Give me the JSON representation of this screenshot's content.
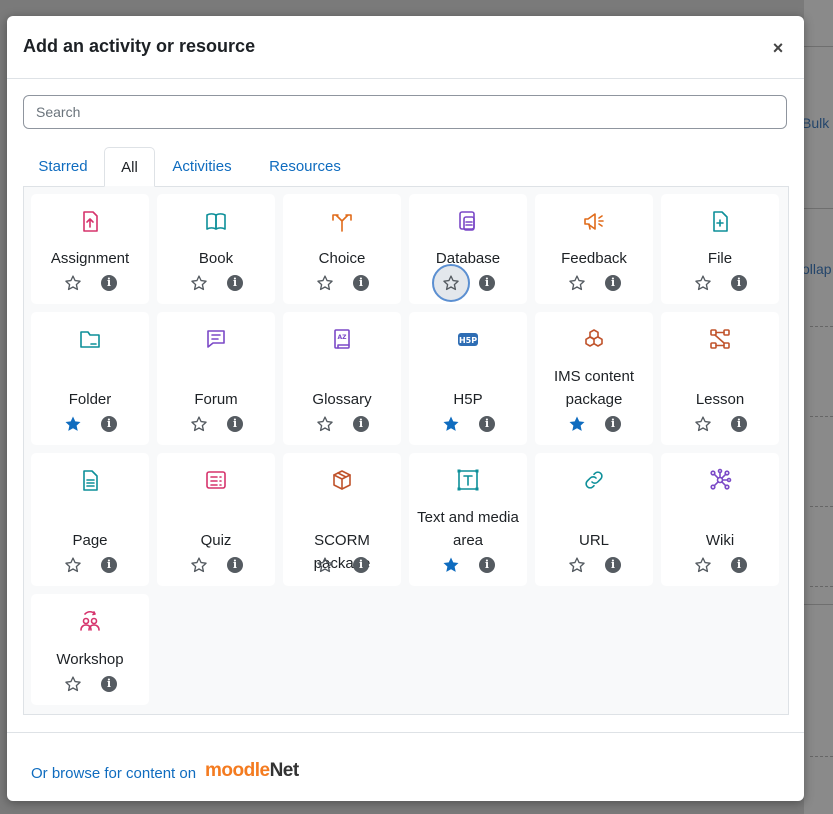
{
  "background": {
    "bulk_text": "Bulk",
    "collapse_text": "ollap"
  },
  "modal": {
    "title": "Add an activity or resource",
    "close_label": "×"
  },
  "search": {
    "placeholder": "Search",
    "value": ""
  },
  "tabs": [
    {
      "label": "Starred",
      "active": false
    },
    {
      "label": "All",
      "active": true
    },
    {
      "label": "Activities",
      "active": false
    },
    {
      "label": "Resources",
      "active": false
    }
  ],
  "items": [
    {
      "name": "Assignment",
      "icon": "assignment-icon",
      "color": "#d6336c",
      "starred": false
    },
    {
      "name": "Book",
      "icon": "book-icon",
      "color": "#0d8f99",
      "starred": false
    },
    {
      "name": "Choice",
      "icon": "choice-icon",
      "color": "#e06b1a",
      "starred": false
    },
    {
      "name": "Database",
      "icon": "database-icon",
      "color": "#7b49c7",
      "starred": false,
      "focused": true
    },
    {
      "name": "Feedback",
      "icon": "feedback-icon",
      "color": "#e06b1a",
      "starred": false
    },
    {
      "name": "File",
      "icon": "file-icon",
      "color": "#0d8f99",
      "starred": false
    },
    {
      "name": "Folder",
      "icon": "folder-icon",
      "color": "#0d8f99",
      "starred": true
    },
    {
      "name": "Forum",
      "icon": "forum-icon",
      "color": "#7b49c7",
      "starred": false
    },
    {
      "name": "Glossary",
      "icon": "glossary-icon",
      "color": "#7b49c7",
      "starred": false
    },
    {
      "name": "H5P",
      "icon": "h5p-icon",
      "color": "#2e6db4",
      "starred": true
    },
    {
      "name": "IMS content package",
      "icon": "ims-package-icon",
      "color": "#c0532b",
      "starred": true
    },
    {
      "name": "Lesson",
      "icon": "lesson-icon",
      "color": "#c0532b",
      "starred": false
    },
    {
      "name": "Page",
      "icon": "page-icon",
      "color": "#0d8f99",
      "starred": false
    },
    {
      "name": "Quiz",
      "icon": "quiz-icon",
      "color": "#d6336c",
      "starred": false
    },
    {
      "name": "SCORM package",
      "icon": "scorm-icon",
      "color": "#c0532b",
      "starred": false
    },
    {
      "name": "Text and media area",
      "icon": "text-media-icon",
      "color": "#0d8f99",
      "starred": true
    },
    {
      "name": "URL",
      "icon": "url-icon",
      "color": "#0d8f99",
      "starred": false
    },
    {
      "name": "Wiki",
      "icon": "wiki-icon",
      "color": "#7b49c7",
      "starred": false
    },
    {
      "name": "Workshop",
      "icon": "workshop-icon",
      "color": "#d6336c",
      "starred": false
    }
  ],
  "info_glyph": "i",
  "footer": {
    "link_text": "Or browse for content on",
    "logo_part1": "moodle",
    "logo_part2": "Net"
  }
}
